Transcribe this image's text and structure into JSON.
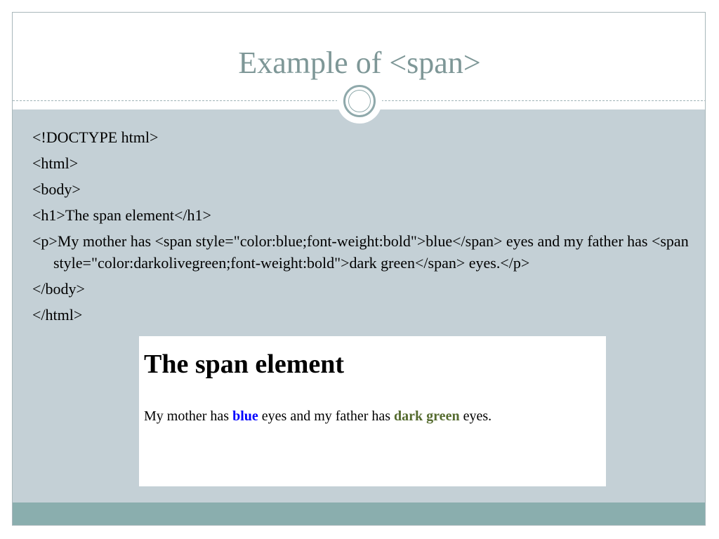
{
  "slide": {
    "title": "Example of <span>"
  },
  "code_lines": [
    "<!DOCTYPE html>",
    "<html>",
    "<body>",
    "<h1>The span element</h1>",
    "<p>My mother has <span style=\"color:blue;font-weight:bold\">blue</span> eyes and my father has <span style=\"color:darkolivegreen;font-weight:bold\">dark green</span> eyes.</p>",
    "</body>",
    "</html>"
  ],
  "preview": {
    "heading": "The span element",
    "para_part1": "My mother has ",
    "para_blue": "blue",
    "para_part2": " eyes and my father has ",
    "para_green": "dark green",
    "para_part3": " eyes."
  },
  "colors": {
    "title": "#7e9797",
    "content_band": "#c4d0d6",
    "footer_band": "#8aaeae",
    "blue_span": "#0000ff",
    "green_span": "#556b2f"
  }
}
